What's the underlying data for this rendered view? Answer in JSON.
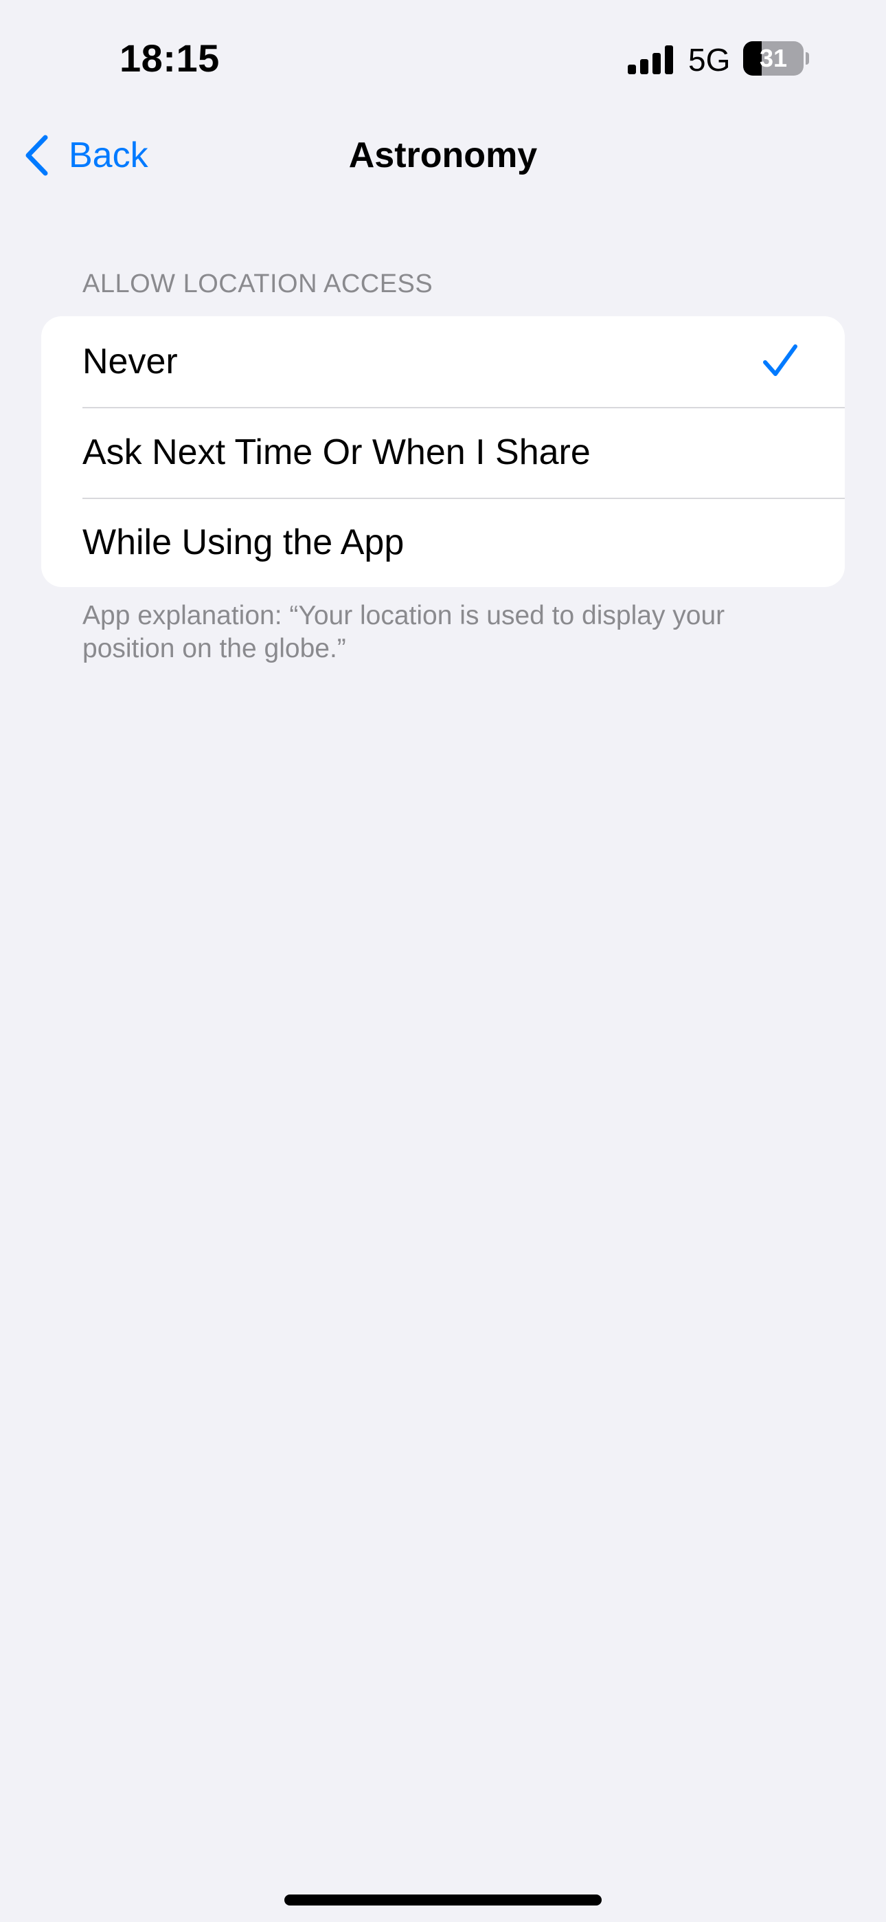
{
  "status_bar": {
    "time": "18:15",
    "network": "5G",
    "battery_level": "31",
    "battery_fraction": 0.31,
    "signal_bars": 4,
    "signal_icon": "cellular-signal-icon",
    "battery_icon": "battery-icon"
  },
  "nav": {
    "back_label": "Back",
    "back_icon": "chevron-left-icon",
    "title": "Astronomy"
  },
  "location_section": {
    "header": "ALLOW LOCATION ACCESS",
    "options": [
      {
        "label": "Never",
        "selected": true
      },
      {
        "label": "Ask Next Time Or When I Share",
        "selected": false
      },
      {
        "label": "While Using the App",
        "selected": false
      }
    ],
    "selected_icon": "checkmark-icon",
    "footer": "App explanation: “Your location is used to display your position on the globe.”"
  },
  "colors": {
    "accent": "#007AFF",
    "background": "#F2F2F7",
    "group_background": "#FFFFFF",
    "secondary_text": "#8A8A8E",
    "separator": "#D8D8DC"
  }
}
